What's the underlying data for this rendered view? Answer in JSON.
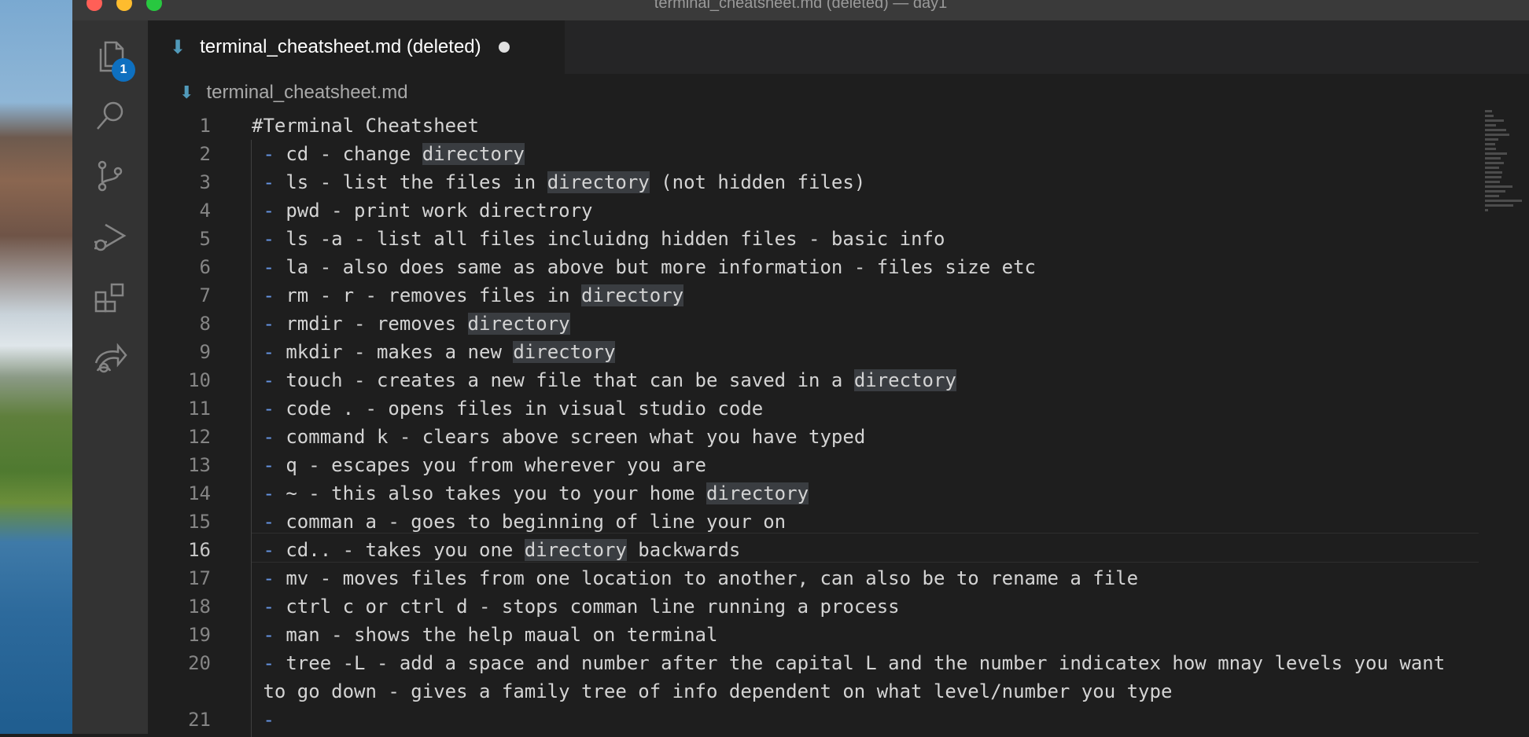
{
  "window": {
    "title": "terminal_cheatsheet.md (deleted) — day1",
    "traffic_lights": [
      "#ff5f57",
      "#febc2e",
      "#28c840"
    ]
  },
  "activity_bar": {
    "icons": [
      "explorer-icon",
      "search-icon",
      "source-control-icon",
      "run-debug-icon",
      "extensions-icon",
      "remote-share-icon"
    ],
    "explorer_badge": "1"
  },
  "tab": {
    "icon": "markdown-icon",
    "label": "terminal_cheatsheet.md (deleted)",
    "modified_indicator": "dirty-dot"
  },
  "breadcrumb": {
    "icon": "markdown-icon",
    "file": "terminal_cheatsheet.md"
  },
  "editor": {
    "active_line": 16,
    "highlight_word": "directory",
    "lines": [
      {
        "n": "1",
        "text": "#Terminal Cheatsheet"
      },
      {
        "n": "2",
        "text": " - cd - change directory"
      },
      {
        "n": "3",
        "text": " - ls - list the files in directory (not hidden files)"
      },
      {
        "n": "4",
        "text": " - pwd - print work directrory"
      },
      {
        "n": "5",
        "text": " - ls -a - list all files incluidng hidden files - basic info"
      },
      {
        "n": "6",
        "text": " - la - also does same as above but more information - files size etc"
      },
      {
        "n": "7",
        "text": " - rm - r - removes files in directory"
      },
      {
        "n": "8",
        "text": " - rmdir - removes directory"
      },
      {
        "n": "9",
        "text": " - mkdir - makes a new directory"
      },
      {
        "n": "10",
        "text": " - touch - creates a new file that can be saved in a directory"
      },
      {
        "n": "11",
        "text": " - code . - opens files in visual studio code"
      },
      {
        "n": "12",
        "text": " - command k - clears above screen what you have typed"
      },
      {
        "n": "13",
        "text": " - q - escapes you from wherever you are"
      },
      {
        "n": "14",
        "text": " - ~ - this also takes you to your home directory"
      },
      {
        "n": "15",
        "text": " - comman a - goes to beginning of line your on"
      },
      {
        "n": "16",
        "text": " - cd.. - takes you one directory backwards"
      },
      {
        "n": "17",
        "text": " - mv - moves files from one location to another, can also be to rename a file"
      },
      {
        "n": "18",
        "text": " - ctrl c or ctrl d - stops comman line running a process"
      },
      {
        "n": "19",
        "text": " - man - shows the help maual on terminal"
      },
      {
        "n": "20",
        "text": " - tree -L - add a space and number after the capital L and the number indicatex how mnay levels you want"
      },
      {
        "n": "",
        "text": " to go down - gives a family tree of info dependent on what level/number you type"
      },
      {
        "n": "21",
        "text": " -"
      }
    ]
  },
  "colors": {
    "editor_bg": "#1e1e1e",
    "activity_bar_bg": "#333333",
    "badge": "#0e70c0",
    "markdown_icon": "#519aba",
    "list_dash": "#6796e6",
    "word_highlight": "#3a3d41"
  }
}
